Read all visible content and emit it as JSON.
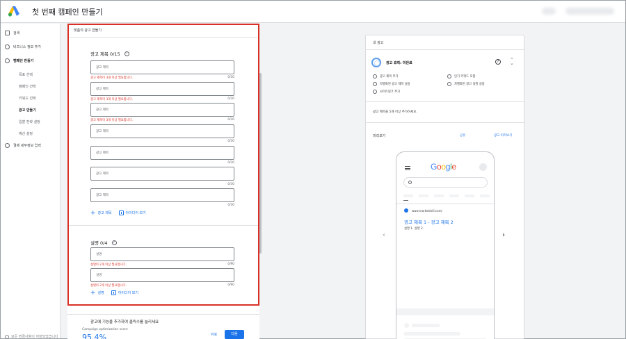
{
  "header": {
    "app_title": "첫 번째 캠페인 만들기"
  },
  "sidebar": {
    "items": [
      {
        "label": "검색"
      },
      {
        "label": "비즈니스 정보 추가"
      },
      {
        "label": "캠페인 만들기"
      },
      {
        "label": "결제 세부정보 입력"
      }
    ],
    "subitems": [
      {
        "label": "목표 선택"
      },
      {
        "label": "캠페인 선택"
      },
      {
        "label": "키워드 선택"
      },
      {
        "label": "광고 만들기"
      },
      {
        "label": "입찰 전략 설정"
      },
      {
        "label": "예산 설정"
      }
    ],
    "footer": "모든 변경사항이 저장되었습니다"
  },
  "form": {
    "header_title": "맞춤의 광고 만들기",
    "headlines_title": "광고 제목 0/15",
    "headlines": [
      {
        "placeholder": "광고 제목",
        "error": "광고 제목이 3개 이상 필요합니다.",
        "count": "0/30"
      },
      {
        "placeholder": "광고 제목",
        "error": "광고 제목이 3개 이상 필요합니다.",
        "count": "0/30"
      },
      {
        "placeholder": "광고 제목",
        "error": "광고 제목이 3개 이상 필요합니다.",
        "count": "0/30"
      },
      {
        "placeholder": "광고 제목",
        "error": "",
        "count": "0/30"
      },
      {
        "placeholder": "광고 제목",
        "error": "",
        "count": "0/30"
      },
      {
        "placeholder": "광고 제목",
        "error": "",
        "count": "0/30"
      },
      {
        "placeholder": "광고 제목",
        "error": "",
        "count": "0/30"
      }
    ],
    "add_headline": "광고 제목",
    "headline_ideas": "아이디어 보기",
    "desc_title": "설명 0/4",
    "descriptions": [
      {
        "placeholder": "설명",
        "error": "설명이 2개 이상 필요합니다.",
        "count": "0/90"
      },
      {
        "placeholder": "설명",
        "error": "설명이 2개 이상 필요합니다.",
        "count": "0/90"
      }
    ],
    "add_desc": "설명",
    "desc_ideas": "아이디어 보기"
  },
  "bottom": {
    "title": "광고에 기능을 추가하여 클릭수를 늘리세요",
    "opt_label": "Campaign optimization score",
    "opt_value": "95.4%",
    "back": "뒤로",
    "next": "다음"
  },
  "preview": {
    "title": "내 광고",
    "strength": "광고 효력: 미완료",
    "tips": [
      "광고 제목 추가",
      "인기 키워드 포함",
      "차별화된 광고 제목 설정",
      "차별화된 광고 설명 설정",
      "사이트링크 추가"
    ],
    "message": "광고 제목을 5개 이상 추가하세요.",
    "preview_label": "미리보기",
    "share": "공유",
    "more": "광고 미리보기",
    "phone": {
      "url": "www.marketskill.com/",
      "ad_title": "광고 제목 1 - 광고 제목 2",
      "ad_desc": "설명 1. 설명 2."
    }
  },
  "colors": {
    "accent": "#1a73e8",
    "error": "#d93025",
    "highlight": "#d93025"
  }
}
